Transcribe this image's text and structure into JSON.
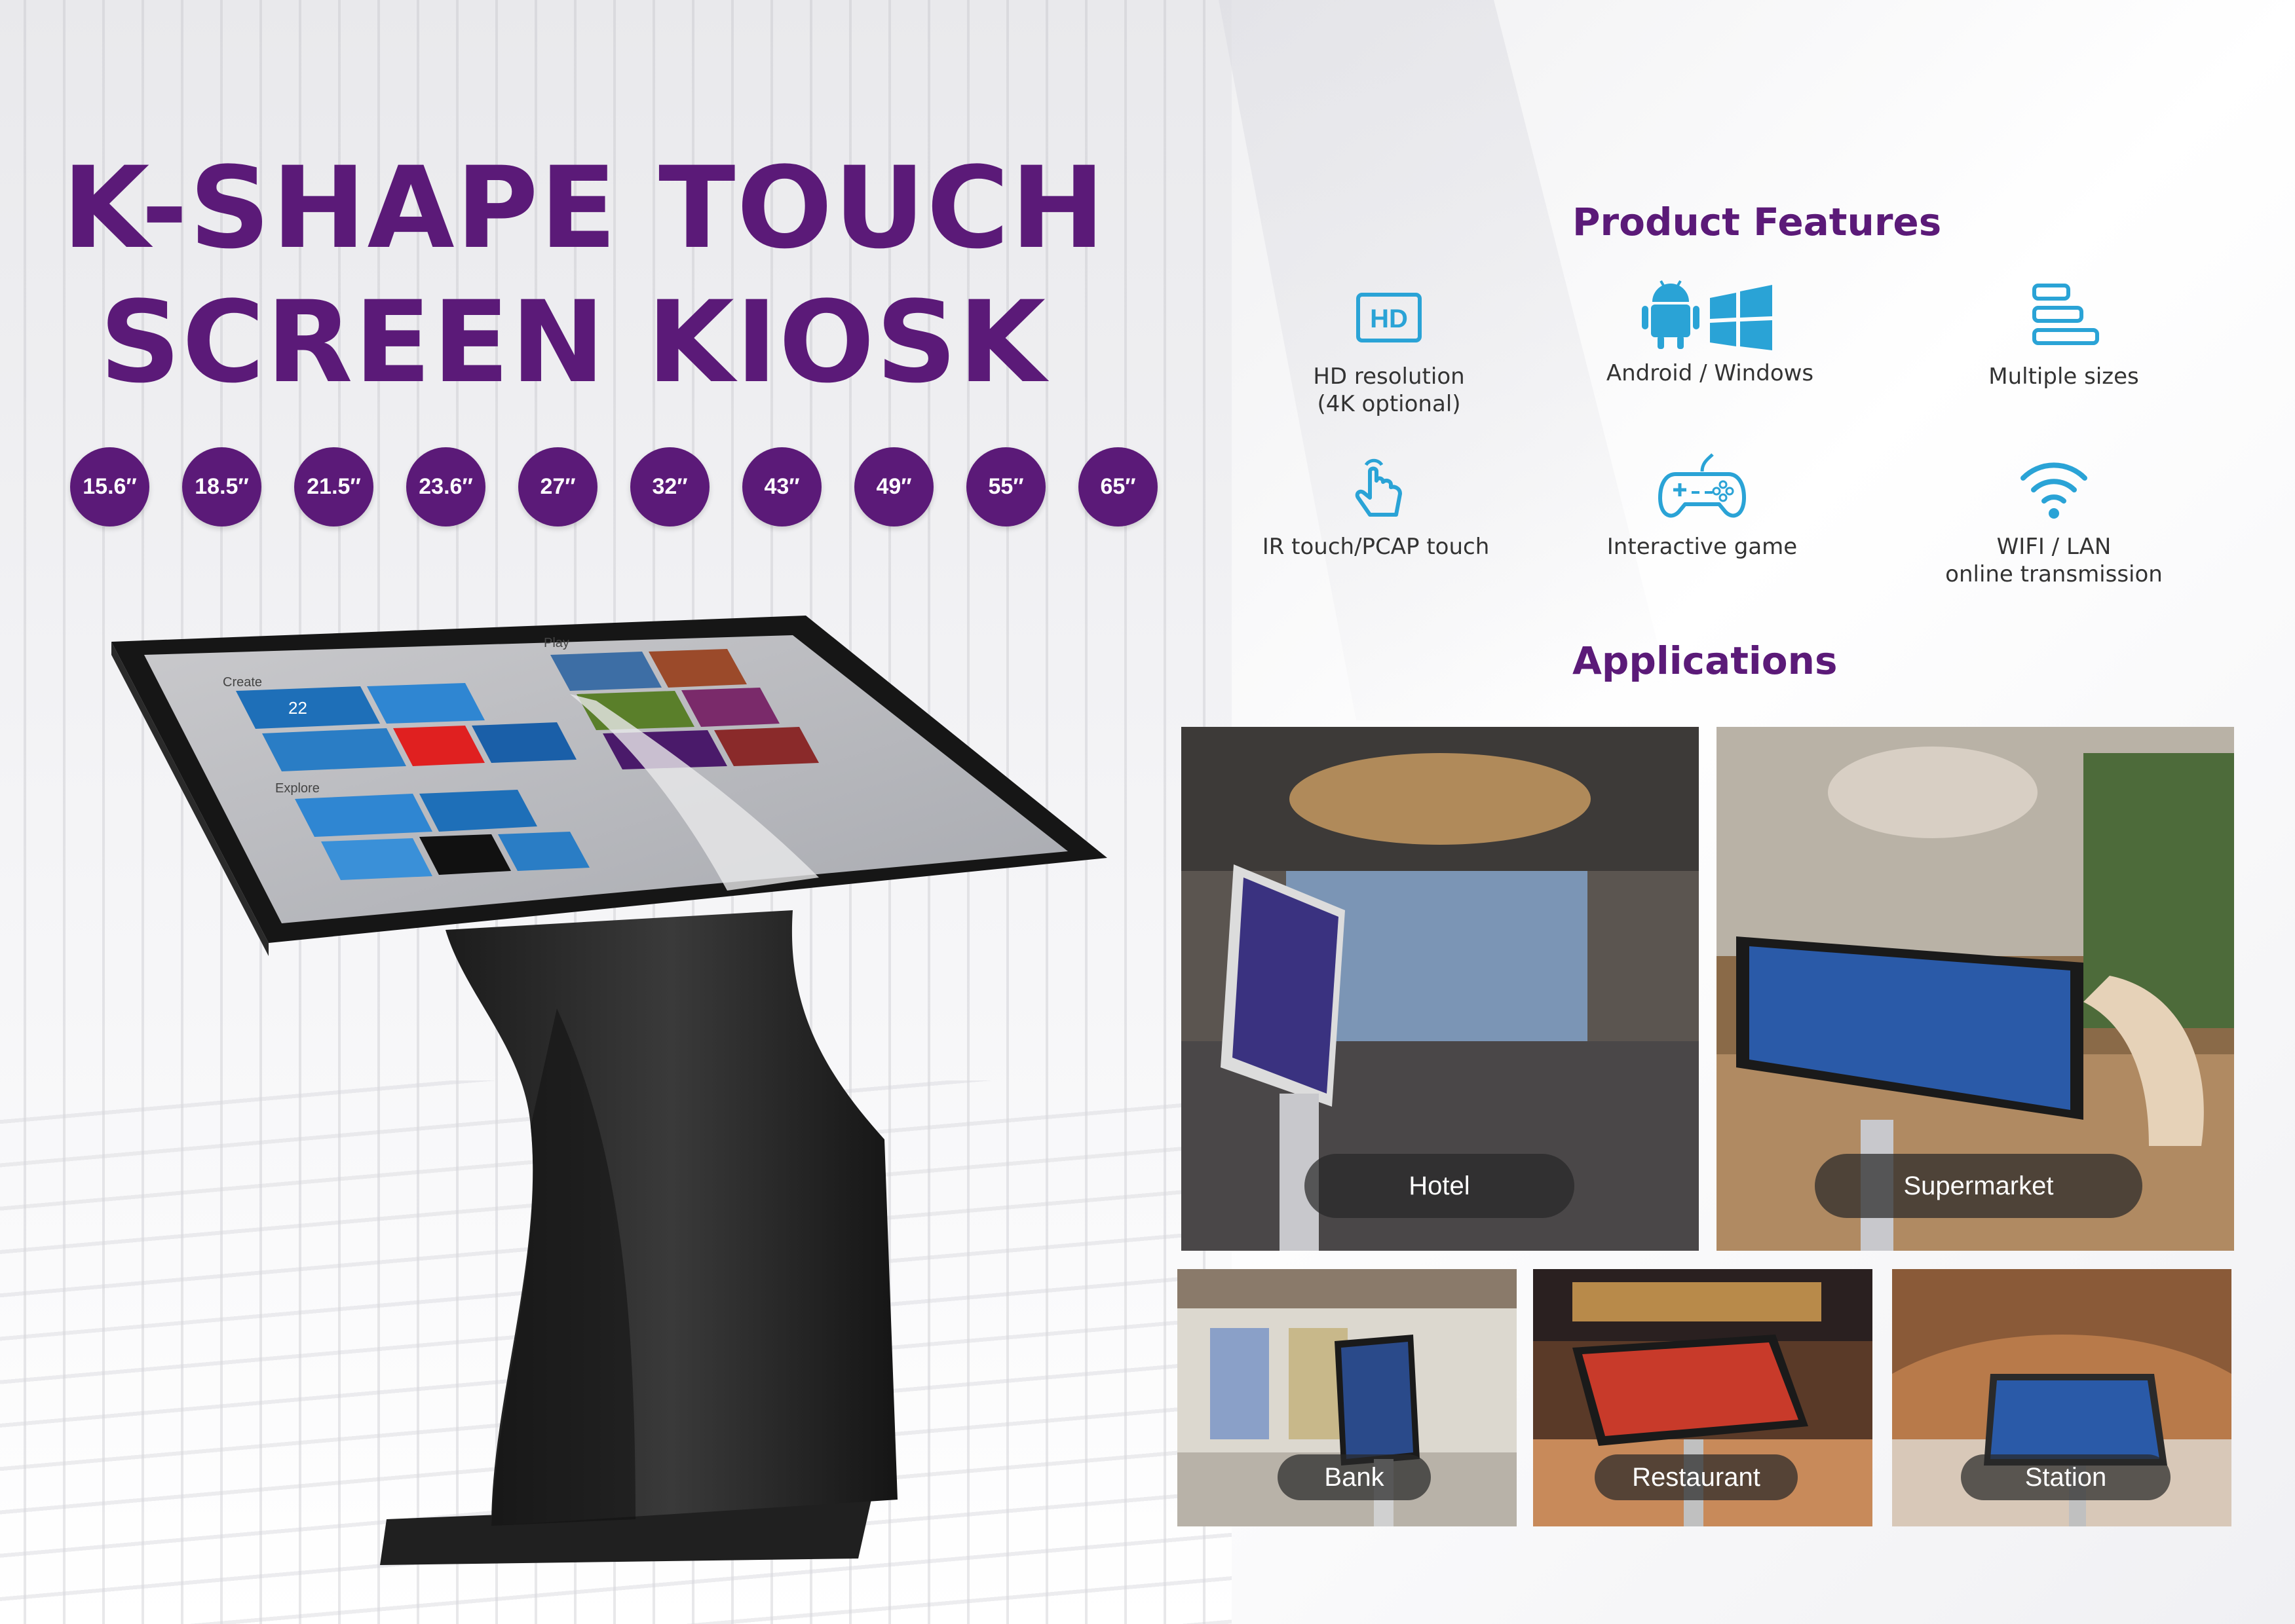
{
  "title": {
    "line1": "K-SHAPE TOUCH",
    "line2": "SCREEN KIOSK"
  },
  "sizes": [
    "15.6′′",
    "18.5′′",
    "21.5′′",
    "23.6′′",
    "27′′",
    "32′′",
    "43′′",
    "49′′",
    "55′′",
    "65′′"
  ],
  "screen": {
    "create": "Create",
    "play": "Play",
    "explore": "Explore",
    "date": "22"
  },
  "features": {
    "heading": "Product Features",
    "items": [
      {
        "icon": "hd-icon",
        "label": "HD resolution\n(4K optional)",
        "line1": "HD resolution",
        "line2": "(4K optional)"
      },
      {
        "icon": "android-windows-icon",
        "line1": "Android / Windows",
        "line2": ""
      },
      {
        "icon": "sizes-bars-icon",
        "line1": "Multiple sizes",
        "line2": ""
      },
      {
        "icon": "touch-hand-icon",
        "line1": "IR touch/PCAP touch",
        "line2": ""
      },
      {
        "icon": "gamepad-icon",
        "line1": "Interactive game",
        "line2": ""
      },
      {
        "icon": "wifi-icon",
        "line1": "WIFI / LAN",
        "line2": "online transmission"
      }
    ]
  },
  "applications": {
    "heading": "Applications",
    "items": [
      "Hotel",
      "Supermarket",
      "Bank",
      "Restaurant",
      "Station"
    ]
  },
  "colors": {
    "brand": "#5b1a78",
    "icon": "#2aa3d6"
  }
}
